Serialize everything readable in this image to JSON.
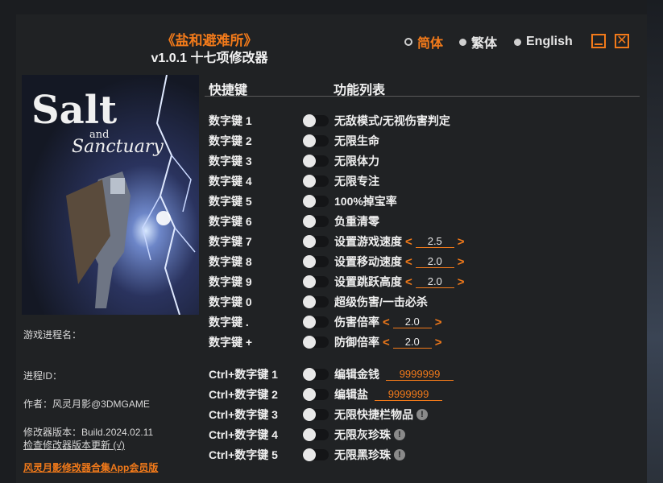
{
  "header": {
    "game_title": "《盐和避难所》",
    "version": "v1.0.1 十七项修改器"
  },
  "languages": [
    {
      "label": "简体",
      "selected": true
    },
    {
      "label": "繁体",
      "selected": false
    },
    {
      "label": "English",
      "selected": false
    }
  ],
  "window_controls": {
    "minimize_icon": "minimize-icon",
    "close_icon": "close-icon",
    "close_glyph": "✕"
  },
  "cover": {
    "logo_line1": "Salt",
    "logo_line2": "and",
    "logo_line3": "Sanctuary"
  },
  "info": {
    "process_name_label": "游戏进程名：",
    "process_id_label": "进程ID：",
    "author": "作者：风灵月影@3DMGAME",
    "build": "修改器版本：Build.2024.02.11",
    "check_update": "检查修改器版本更新 (√)",
    "promo": "风灵月影修改器合集App会员版"
  },
  "columns": {
    "hotkey": "快捷键",
    "functions": "功能列表"
  },
  "cheats": [
    {
      "key": "数字键 1",
      "label": "无敌模式/无视伤害判定"
    },
    {
      "key": "数字键 2",
      "label": "无限生命"
    },
    {
      "key": "数字键 3",
      "label": "无限体力"
    },
    {
      "key": "数字键 4",
      "label": "无限专注"
    },
    {
      "key": "数字键 5",
      "label": "100%掉宝率"
    },
    {
      "key": "数字键 6",
      "label": "负重清零"
    },
    {
      "key": "数字键 7",
      "label": "设置游戏速度",
      "value": "2.5"
    },
    {
      "key": "数字键 8",
      "label": "设置移动速度",
      "value": "2.0"
    },
    {
      "key": "数字键 9",
      "label": "设置跳跃高度",
      "value": "2.0"
    },
    {
      "key": "数字键 0",
      "label": "超级伤害/一击必杀"
    },
    {
      "key": "数字键 .",
      "label": "伤害倍率",
      "value": "2.0"
    },
    {
      "key": "数字键 +",
      "label": "防御倍率",
      "value": "2.0"
    },
    {
      "key": "Ctrl+数字键 1",
      "label": "编辑金钱",
      "amount": "9999999"
    },
    {
      "key": "Ctrl+数字键 2",
      "label": "编辑盐",
      "amount": "9999999"
    },
    {
      "key": "Ctrl+数字键 3",
      "label": "无限快捷栏物品",
      "warn": "!"
    },
    {
      "key": "Ctrl+数字键 4",
      "label": "无限灰珍珠",
      "warn": "!"
    },
    {
      "key": "Ctrl+数字键 5",
      "label": "无限黑珍珠",
      "warn": "!"
    }
  ],
  "arrows": {
    "left": "<",
    "right": ">"
  }
}
